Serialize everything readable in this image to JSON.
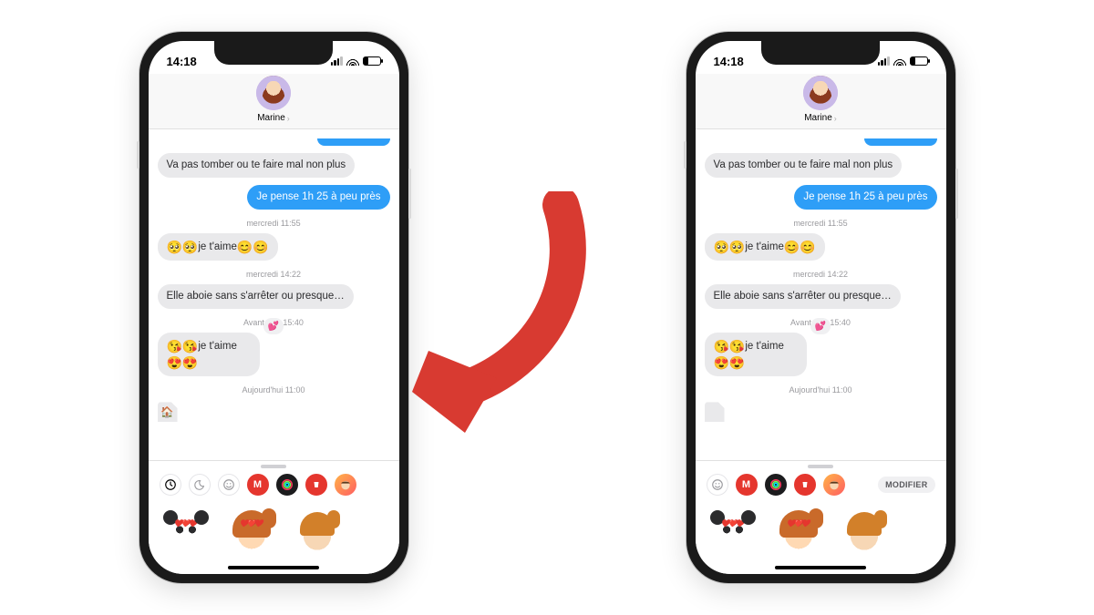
{
  "status": {
    "time": "14:18"
  },
  "contact": {
    "name": "Marine"
  },
  "messages": {
    "m1": "Va pas tomber ou te faire mal non plus",
    "m2": "Je pense 1h 25 à peu près",
    "ts1": "mercredi 11:55",
    "m3_pre": "🥺🥺",
    "m3_text": "je t'aime",
    "m3_post": "😊😊",
    "ts2": "mercredi 14:22",
    "m4": "Elle aboie sans s'arrêter ou presque…",
    "ts3": "Avant-hier 15:40",
    "m5_pre": "😘😘",
    "m5_text": "je t'aime",
    "m5_post": "😍😍",
    "reaction": "💕",
    "ts4": "Aujourd'hui 11:00"
  },
  "drawer": {
    "edit_label": "MODIFIER",
    "apps_left": {
      "recents": "recents",
      "moon": "dnd",
      "smiley": "emoji",
      "red_m": "M",
      "fitness": "fitness-rings",
      "cup": "cup",
      "memoji_mini": "memoji"
    },
    "apps_right": {
      "smiley": "emoji",
      "red_m": "M",
      "fitness": "fitness-rings",
      "cup": "cup",
      "memoji_mini": "memoji"
    }
  },
  "colors": {
    "sent_bubble": "#2e9ef7",
    "recv_bubble": "#e9e9eb",
    "accent_red": "#e5362e",
    "arrow": "#d83a31"
  }
}
